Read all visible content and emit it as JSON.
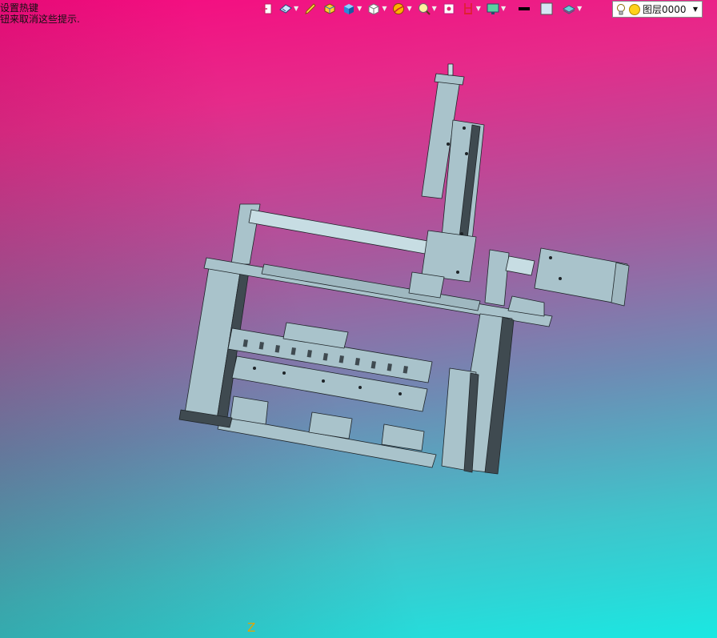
{
  "hint": {
    "line1": "设置热键",
    "line2": "钮来取消这些提示."
  },
  "toolbar": {
    "items": [
      {
        "icon": "exit-icon"
      },
      {
        "icon": "view-orientation-icon",
        "dropdown": true
      },
      {
        "icon": "pencil-icon"
      },
      {
        "icon": "display-mode-icon"
      },
      {
        "icon": "shaded-cube-icon",
        "dropdown": true
      },
      {
        "icon": "white-cube-icon",
        "dropdown": true
      },
      {
        "icon": "section-view-icon",
        "dropdown": true
      },
      {
        "icon": "zoom-icon",
        "dropdown": true
      },
      {
        "icon": "frame-icon"
      },
      {
        "icon": "red-bracket-icon",
        "dropdown": true
      },
      {
        "icon": "monitor-icon",
        "dropdown": true
      },
      {
        "icon": "black-line-icon"
      },
      {
        "icon": "color-swatch-icon"
      },
      {
        "icon": "layer-stack-icon",
        "dropdown": true
      }
    ]
  },
  "layer": {
    "value": "图层0000"
  },
  "axis": {
    "label": "Z"
  },
  "colors": {
    "part": "#a9c3cb",
    "part_dark": "#3f4a50",
    "part_edge": "#1e2428",
    "axis": "#e5a400"
  }
}
